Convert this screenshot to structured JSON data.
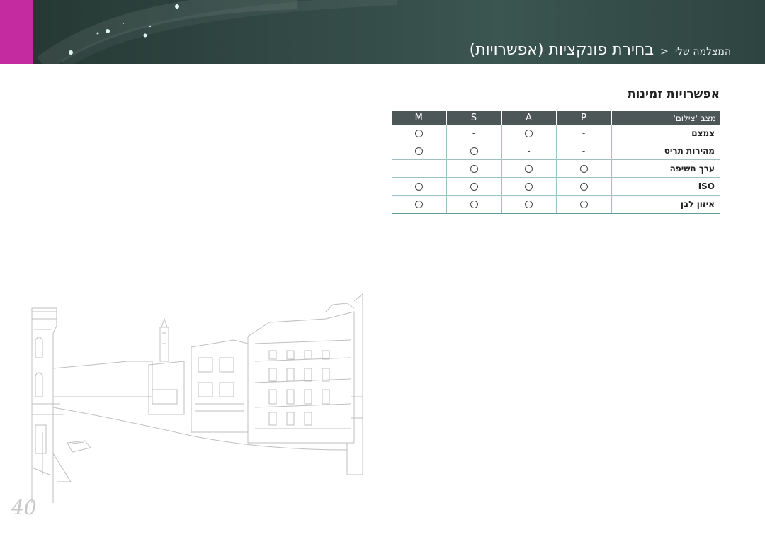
{
  "header": {
    "breadcrumb": "המצלמה שלי",
    "separator": "<",
    "title": "בחירת פונקציות (אפשרויות)"
  },
  "section": {
    "title": "אפשרויות זמינות"
  },
  "table": {
    "feature_header": "מצב 'צילום'",
    "mode_headers": [
      "M",
      "S",
      "A",
      "P"
    ],
    "rows": [
      {
        "feature": "צמצם",
        "values": [
          "O",
          "-",
          "O",
          "-"
        ]
      },
      {
        "feature": "מהירות תריס",
        "values": [
          "O",
          "O",
          "-",
          "-"
        ]
      },
      {
        "feature": "ערך חשיפה",
        "values": [
          "-",
          "O",
          "O",
          "O"
        ]
      },
      {
        "feature": "ISO",
        "values": [
          "O",
          "O",
          "O",
          "O"
        ]
      },
      {
        "feature": "איזון לבן",
        "values": [
          "O",
          "O",
          "O",
          "O"
        ]
      }
    ]
  },
  "page_number": "40",
  "colors": {
    "header_bg": "#2f4541",
    "accent_tab": "#c42ba0",
    "table_header_bg": "#4d5757",
    "table_rule": "#9cc3c0"
  }
}
